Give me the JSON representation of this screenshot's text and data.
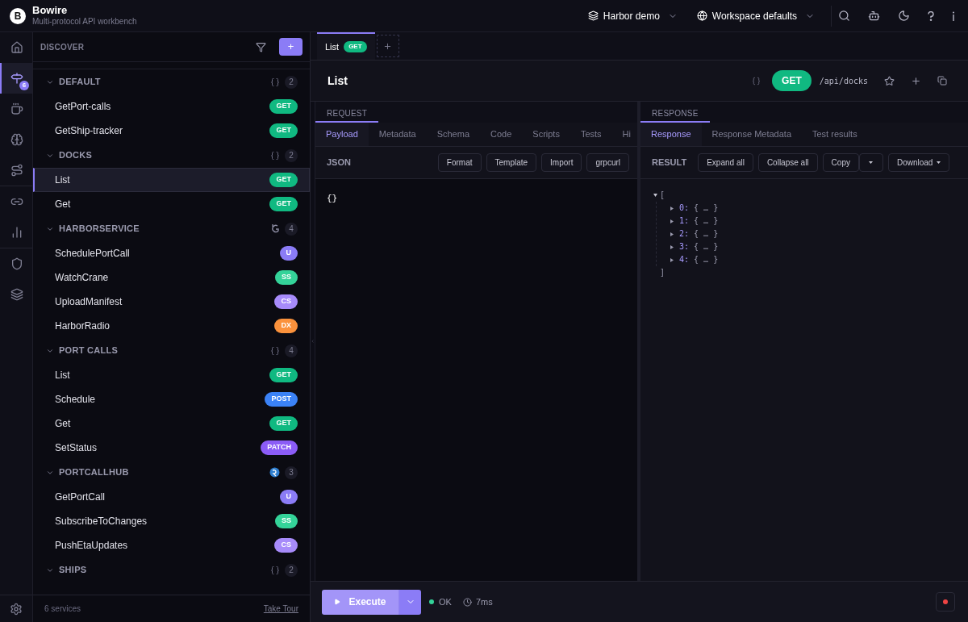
{
  "app": {
    "title": "Bowire",
    "subtitle": "Multi-protocol API workbench",
    "logo_letter": "B"
  },
  "header": {
    "workspace": "Harbor demo",
    "environment": "Workspace defaults"
  },
  "rail": [
    {
      "selected": false
    },
    {
      "selected": true,
      "badge": "6"
    },
    {
      "selected": false
    },
    {
      "selected": false
    },
    {
      "selected": false
    },
    {
      "selected": false
    },
    {
      "selected": false
    },
    {
      "selected": false
    },
    {
      "selected": false
    }
  ],
  "sidebar": {
    "title": "DISCOVER",
    "add_label": "+",
    "footer_count": "6 services",
    "footer_link": "Take Tour",
    "groups": [
      {
        "name": "DEFAULT",
        "kind": "rest",
        "count": "2",
        "expanded": true,
        "items": [
          {
            "name": "GetPort-calls",
            "method": "GET",
            "color": "#10b981",
            "selected": false
          },
          {
            "name": "GetShip-tracker",
            "method": "GET",
            "color": "#10b981",
            "selected": false
          }
        ]
      },
      {
        "name": "DOCKS",
        "kind": "rest",
        "count": "2",
        "expanded": true,
        "items": [
          {
            "name": "List",
            "method": "GET",
            "color": "#10b981",
            "selected": true
          },
          {
            "name": "Get",
            "method": "GET",
            "color": "#10b981",
            "selected": false
          }
        ]
      },
      {
        "name": "HARBORSERVICE",
        "kind": "grpc",
        "count": "4",
        "expanded": true,
        "items": [
          {
            "name": "SchedulePortCall",
            "method": "U",
            "color": "#8b7cf6",
            "selected": false
          },
          {
            "name": "WatchCrane",
            "method": "SS",
            "color": "#34d399",
            "selected": false
          },
          {
            "name": "UploadManifest",
            "method": "CS",
            "color": "#a78bfa",
            "selected": false
          },
          {
            "name": "HarborRadio",
            "method": "DX",
            "color": "#fb923c",
            "selected": false
          }
        ]
      },
      {
        "name": "PORT CALLS",
        "kind": "rest",
        "count": "4",
        "expanded": true,
        "items": [
          {
            "name": "List",
            "method": "GET",
            "color": "#10b981",
            "selected": false
          },
          {
            "name": "Schedule",
            "method": "POST",
            "color": "#3b82f6",
            "selected": false
          },
          {
            "name": "Get",
            "method": "GET",
            "color": "#10b981",
            "selected": false
          },
          {
            "name": "SetStatus",
            "method": "PATCH",
            "color": "#8b5cf6",
            "selected": false
          }
        ]
      },
      {
        "name": "PORTCALLHUB",
        "kind": "signalr",
        "count": "3",
        "expanded": true,
        "items": [
          {
            "name": "GetPortCall",
            "method": "U",
            "color": "#8b7cf6",
            "selected": false
          },
          {
            "name": "SubscribeToChanges",
            "method": "SS",
            "color": "#34d399",
            "selected": false
          },
          {
            "name": "PushEtaUpdates",
            "method": "CS",
            "color": "#a78bfa",
            "selected": false
          }
        ]
      },
      {
        "name": "SHIPS",
        "kind": "rest",
        "count": "2",
        "expanded": true
      }
    ]
  },
  "open_tabs": [
    {
      "label": "List",
      "method": "GET",
      "selected": true
    }
  ],
  "endpoint": {
    "title": "List",
    "method": "GET",
    "path": "/api/docks"
  },
  "request": {
    "label": "REQUEST",
    "tabs": [
      {
        "label": "Payload",
        "selected": true
      },
      {
        "label": "Metadata",
        "selected": false
      },
      {
        "label": "Schema",
        "selected": false
      },
      {
        "label": "Code",
        "selected": false
      },
      {
        "label": "Scripts",
        "selected": false
      },
      {
        "label": "Tests",
        "selected": false
      },
      {
        "label": "Hi",
        "selected": false
      }
    ],
    "format": "JSON",
    "buttons": [
      "Format",
      "Template",
      "Import",
      "grpcurl"
    ],
    "body": "{}"
  },
  "response": {
    "label": "RESPONSE",
    "tabs": [
      {
        "label": "Response",
        "selected": true
      },
      {
        "label": "Response Metadata",
        "selected": false
      },
      {
        "label": "Test results",
        "selected": false
      }
    ],
    "format": "RESULT",
    "buttons": [
      "Expand all",
      "Collapse all",
      "Copy"
    ],
    "download": "Download",
    "tree": {
      "open": "[",
      "close": "]",
      "expanded": true,
      "items": [
        {
          "key": "0:",
          "preview": "{ … }",
          "expanded": false
        },
        {
          "key": "1:",
          "preview": "{ … }",
          "expanded": false
        },
        {
          "key": "2:",
          "preview": "{ … }",
          "expanded": false
        },
        {
          "key": "3:",
          "preview": "{ … }",
          "expanded": false
        },
        {
          "key": "4:",
          "preview": "{ … }",
          "expanded": false
        }
      ]
    }
  },
  "footer": {
    "execute": "Execute",
    "status": "OK",
    "time": "7ms",
    "recording": true
  }
}
